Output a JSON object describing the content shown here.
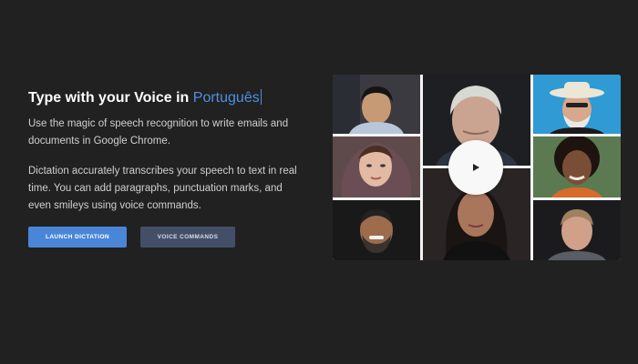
{
  "hero": {
    "title_prefix": "Type with your Voice in",
    "language": "Português",
    "paragraph_1": "Use the magic of speech recognition to write emails and documents in Google Chrome.",
    "paragraph_2": "Dictation accurately transcribes your speech to text in real time. You can add paragraphs, punctuation marks, and even smileys using voice commands."
  },
  "buttons": {
    "launch_label": "LAUNCH DICTATION",
    "commands_label": "VOICE COMMANDS"
  },
  "video": {
    "play_icon": "play-icon",
    "portraits": 9
  },
  "colors": {
    "background": "#212121",
    "accent": "#4a86d8",
    "language_text": "#4f8fe0",
    "secondary_button": "#424f66"
  }
}
